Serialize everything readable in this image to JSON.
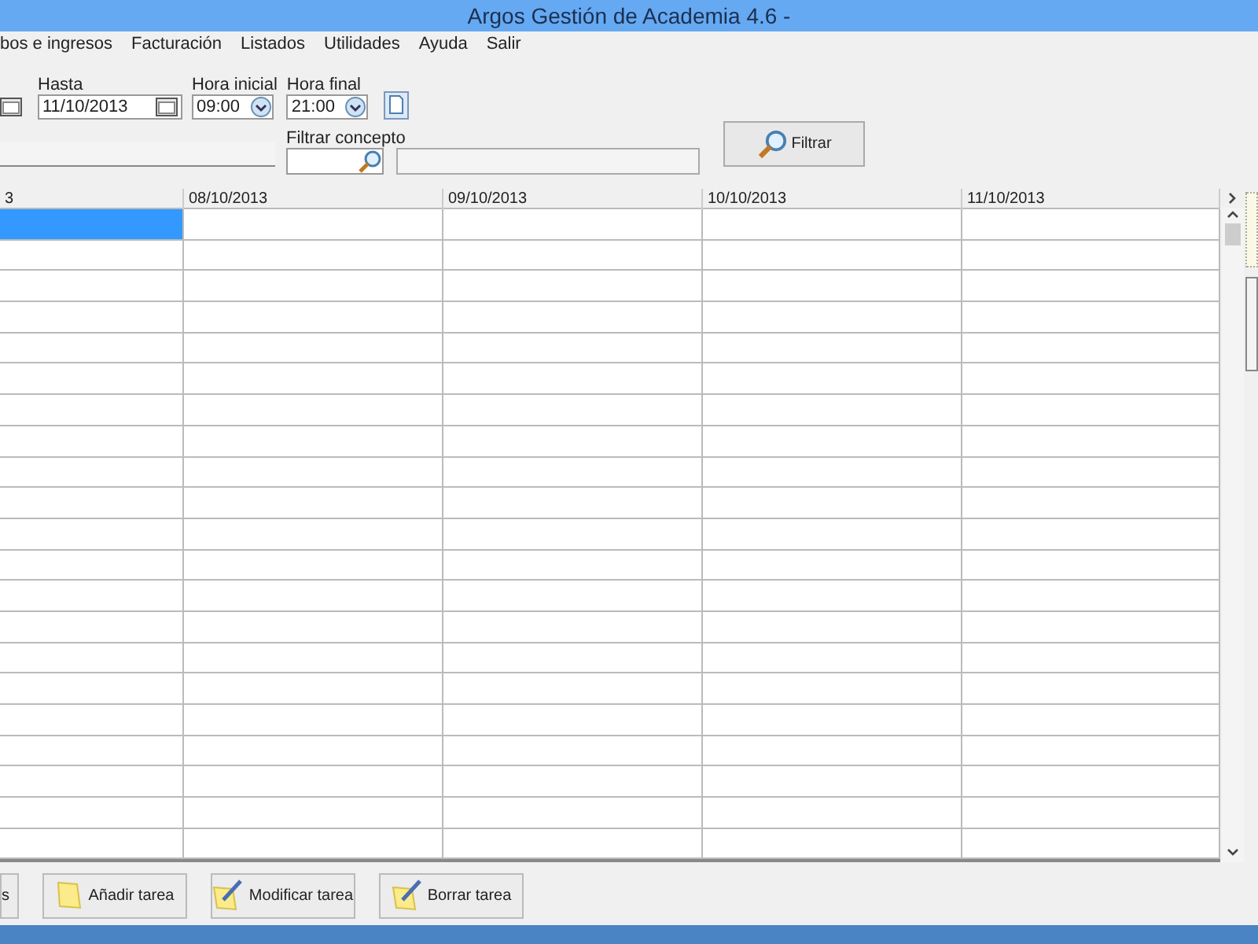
{
  "window": {
    "title": "Argos Gestión de Academia 4.6 -"
  },
  "menu": [
    "bos e ingresos",
    "Facturación",
    "Listados",
    "Utilidades",
    "Ayuda",
    "Salir"
  ],
  "filters": {
    "hasta": {
      "label": "Hasta",
      "value": "11/10/2013"
    },
    "hora_inicial": {
      "label": "Hora inicial",
      "value": "09:00"
    },
    "hora_final": {
      "label": "Hora final",
      "value": "21:00"
    },
    "concepto": {
      "label": "Filtrar concepto"
    },
    "filter_button": "Filtrar"
  },
  "table": {
    "columns": [
      "3",
      "08/10/2013",
      "09/10/2013",
      "10/10/2013",
      "11/10/2013"
    ],
    "rows": [
      {
        "selected": true
      },
      {
        "selected": false
      },
      {
        "selected": false
      },
      {
        "selected": false
      },
      {
        "selected": false
      },
      {
        "selected": false
      },
      {
        "selected": false
      },
      {
        "selected": false
      },
      {
        "selected": false
      },
      {
        "selected": false
      },
      {
        "selected": false
      },
      {
        "selected": false
      },
      {
        "selected": false
      },
      {
        "selected": false
      },
      {
        "selected": false
      },
      {
        "selected": false
      },
      {
        "selected": false
      },
      {
        "selected": false
      },
      {
        "selected": false
      },
      {
        "selected": false
      },
      {
        "selected": false
      }
    ]
  },
  "buttons": [
    {
      "label": "s",
      "kind": "plain"
    },
    {
      "label": "Añadir tarea",
      "kind": "add"
    },
    {
      "label": "Modificar tarea",
      "kind": "edit"
    },
    {
      "label": "Borrar tarea",
      "kind": "edit"
    }
  ]
}
